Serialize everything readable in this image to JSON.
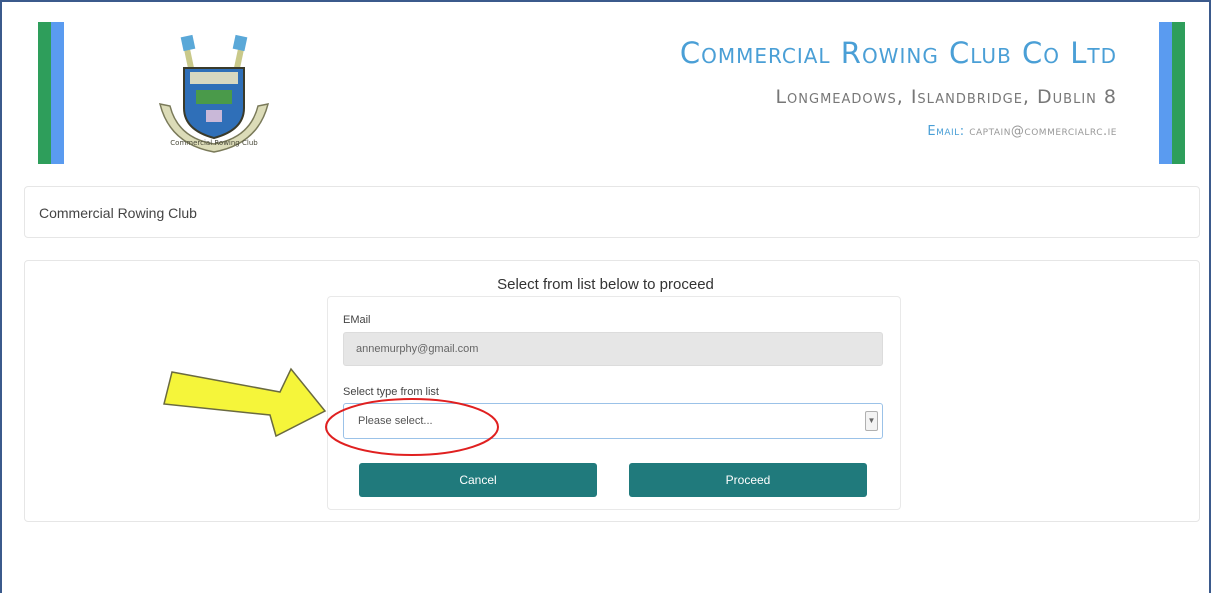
{
  "header": {
    "title": "Commercial Rowing Club Co Ltd",
    "address": "Longmeadows, Islandbridge, Dublin 8",
    "email_label": "Email:",
    "email_value": "captain@commercialrc.ie",
    "logo_icon": "rowing-club-crest-icon",
    "logo_text": "Commercial Rowing Club"
  },
  "breadcrumb": {
    "label": "Commercial Rowing Club"
  },
  "form": {
    "instruction": "Select from list below to proceed",
    "email_label": "EMail",
    "email_value": "annemurphy@gmail.com",
    "type_label": "Select type from list",
    "type_selected": "Please select...",
    "cancel_label": "Cancel",
    "proceed_label": "Proceed"
  },
  "annotations": {
    "arrow_color": "#f5f53a",
    "circle_color": "#e02020"
  },
  "colors": {
    "accent_blue": "#4a9fd6",
    "button_teal": "#207a7c",
    "stripe_green": "#2e9e5b",
    "stripe_blue": "#5a9bf0"
  }
}
